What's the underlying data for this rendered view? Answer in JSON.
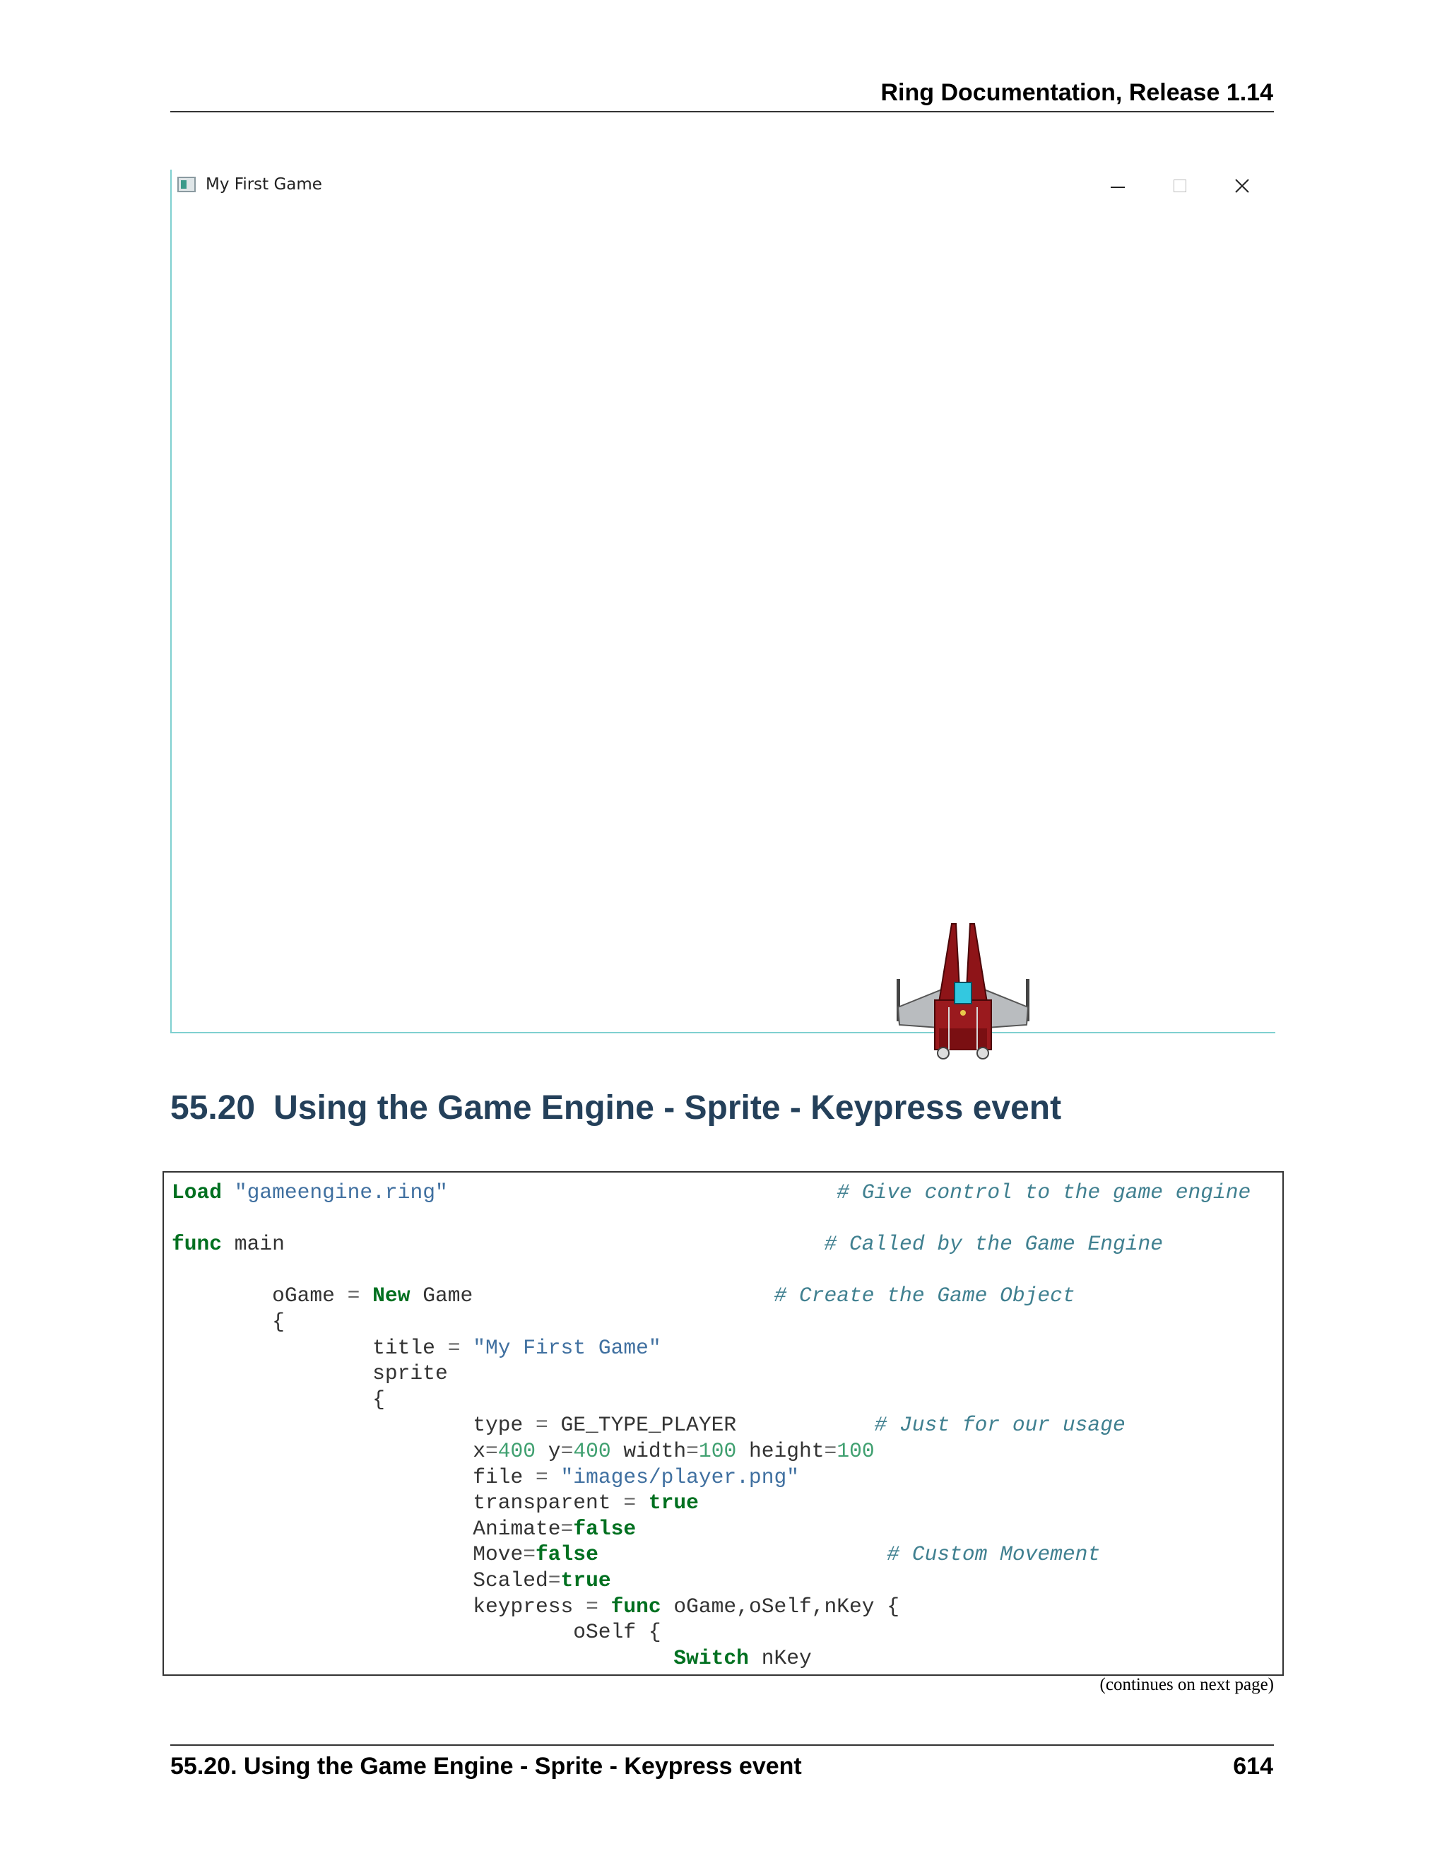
{
  "header": {
    "title": "Ring Documentation, Release 1.14"
  },
  "window": {
    "title": "My First Game",
    "icon": "app-icon",
    "controls": [
      "minimize-icon",
      "maximize-icon",
      "close-icon"
    ],
    "sprite": "player-spaceship-image"
  },
  "section": {
    "number": "55.20",
    "title": "Using the Game Engine - Sprite - Keypress event"
  },
  "code": {
    "lines": [
      [
        [
          "kw",
          "Load"
        ],
        [
          "t",
          " "
        ],
        [
          "str",
          "\"gameengine.ring\""
        ],
        [
          "t",
          "                               "
        ],
        [
          "cm",
          "# Give control to the game engine"
        ]
      ],
      [],
      [
        [
          "kw",
          "func"
        ],
        [
          "t",
          " main                                           "
        ],
        [
          "cm",
          "# Called by the Game Engine"
        ]
      ],
      [],
      [
        [
          "t",
          "        oGame "
        ],
        [
          "op",
          "="
        ],
        [
          "t",
          " "
        ],
        [
          "kw",
          "New"
        ],
        [
          "t",
          " Game                        "
        ],
        [
          "cm",
          "# Create the Game Object"
        ]
      ],
      [
        [
          "t",
          "        {"
        ]
      ],
      [
        [
          "t",
          "                title "
        ],
        [
          "op",
          "="
        ],
        [
          "t",
          " "
        ],
        [
          "str",
          "\"My First Game\""
        ]
      ],
      [
        [
          "t",
          "                sprite"
        ]
      ],
      [
        [
          "t",
          "                {"
        ]
      ],
      [
        [
          "t",
          "                        type "
        ],
        [
          "op",
          "="
        ],
        [
          "t",
          " GE_TYPE_PLAYER           "
        ],
        [
          "cm",
          "# Just for our usage"
        ]
      ],
      [
        [
          "t",
          "                        x"
        ],
        [
          "op",
          "="
        ],
        [
          "num",
          "400"
        ],
        [
          "t",
          " y"
        ],
        [
          "op",
          "="
        ],
        [
          "num",
          "400"
        ],
        [
          "t",
          " width"
        ],
        [
          "op",
          "="
        ],
        [
          "num",
          "100"
        ],
        [
          "t",
          " height"
        ],
        [
          "op",
          "="
        ],
        [
          "num",
          "100"
        ]
      ],
      [
        [
          "t",
          "                        file "
        ],
        [
          "op",
          "="
        ],
        [
          "t",
          " "
        ],
        [
          "str",
          "\"images/player.png\""
        ]
      ],
      [
        [
          "t",
          "                        transparent "
        ],
        [
          "op",
          "="
        ],
        [
          "t",
          " "
        ],
        [
          "kw",
          "true"
        ]
      ],
      [
        [
          "t",
          "                        Animate"
        ],
        [
          "op",
          "="
        ],
        [
          "kw",
          "false"
        ]
      ],
      [
        [
          "t",
          "                        Move"
        ],
        [
          "op",
          "="
        ],
        [
          "kw",
          "false"
        ],
        [
          "t",
          "                       "
        ],
        [
          "cm",
          "# Custom Movement"
        ]
      ],
      [
        [
          "t",
          "                        Scaled"
        ],
        [
          "op",
          "="
        ],
        [
          "kw",
          "true"
        ]
      ],
      [
        [
          "t",
          "                        keypress "
        ],
        [
          "op",
          "="
        ],
        [
          "t",
          " "
        ],
        [
          "kw",
          "func"
        ],
        [
          "t",
          " oGame,oSelf,nKey {"
        ]
      ],
      [
        [
          "t",
          "                                oSelf {"
        ]
      ],
      [
        [
          "t",
          "                                        "
        ],
        [
          "kw",
          "Switch"
        ],
        [
          "t",
          " nKey"
        ]
      ]
    ]
  },
  "continues_note": "(continues on next page)",
  "footer": {
    "left": "55.20.  Using the Game Engine - Sprite - Keypress event",
    "page": "614"
  }
}
